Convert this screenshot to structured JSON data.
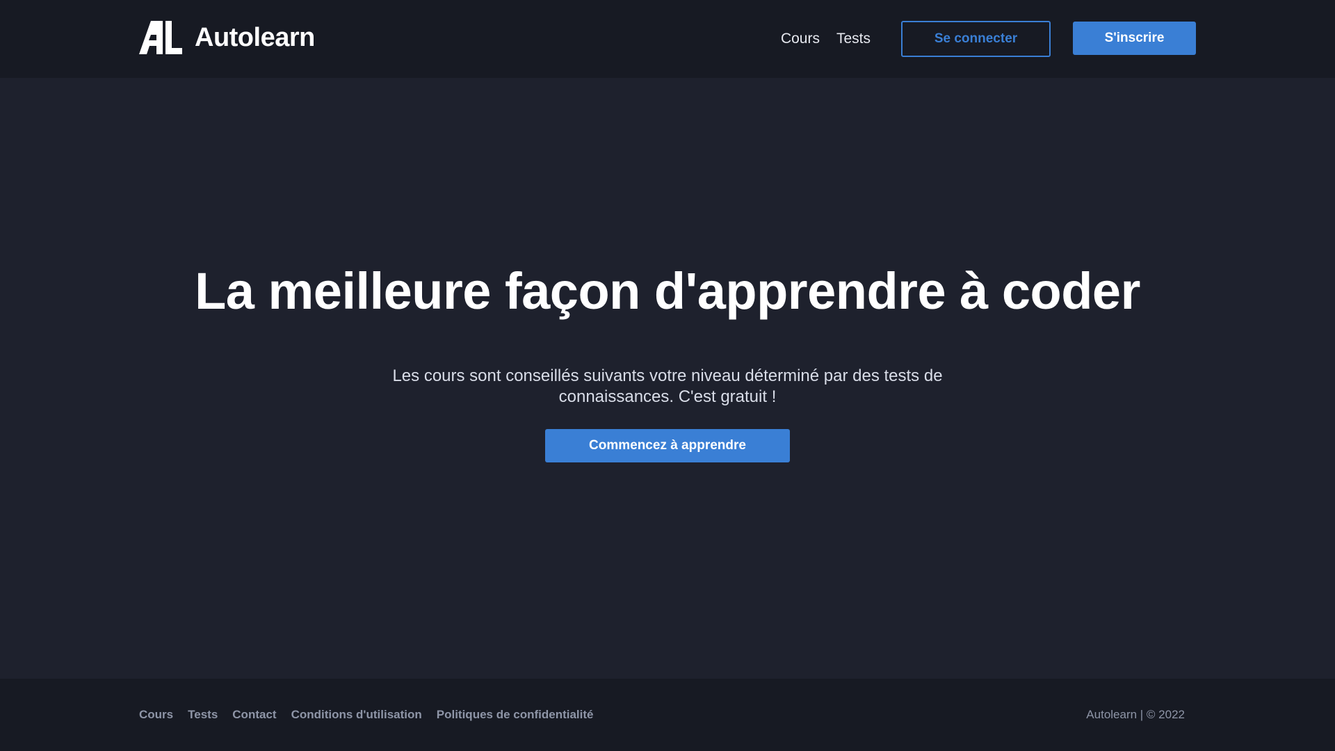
{
  "brand": {
    "name": "Autolearn",
    "logo_mark": "AL"
  },
  "header": {
    "nav": [
      "Cours",
      "Tests"
    ],
    "login_label": "Se connecter",
    "signup_label": "S'inscrire"
  },
  "hero": {
    "title": "La meilleure façon d'apprendre à coder",
    "subtitle": "Les cours sont conseillés suivants votre niveau déterminé par des tests de connaissances. C'est gratuit !",
    "cta_label": "Commencez à apprendre"
  },
  "footer": {
    "links": [
      "Cours",
      "Tests",
      "Contact",
      "Conditions d'utilisation",
      "Politiques de confidentialité"
    ],
    "copyright": "Autolearn | © 2022"
  },
  "colors": {
    "page_bg": "#1e212d",
    "bar_bg": "#171a23",
    "accent": "#3a7fd5",
    "muted_text": "#8e95a7"
  }
}
